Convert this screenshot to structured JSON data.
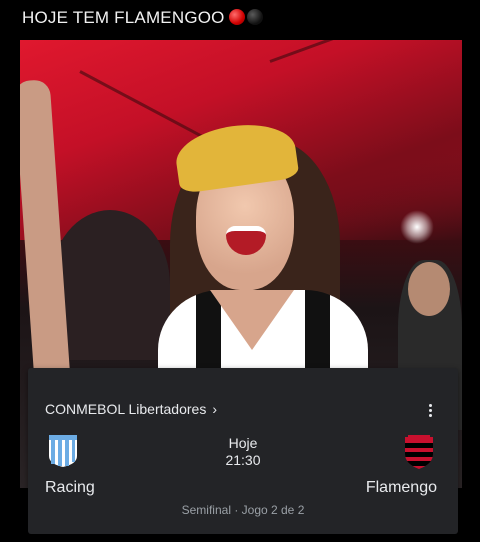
{
  "post": {
    "title": "HOJE TEM FLAMENGOO",
    "emoji_icons": [
      "red-circle-icon",
      "black-circle-icon"
    ]
  },
  "match_card": {
    "league": "CONMEBOL Libertadores",
    "league_chevron": "›",
    "more_icon": "more-vert-icon",
    "home_team": {
      "name": "Racing",
      "logo": "racing-crest-icon",
      "colors": [
        "#6cace4",
        "#ffffff"
      ]
    },
    "away_team": {
      "name": "Flamengo",
      "logo": "flamengo-crest-icon",
      "colors": [
        "#c8102e",
        "#000000"
      ]
    },
    "day": "Hoje",
    "time": "21:30",
    "stage": "Semifinal · Jogo 2 de 2"
  },
  "colors": {
    "card_bg": "#232427",
    "text_primary": "#e8eaed",
    "text_secondary": "#9aa0a6"
  }
}
